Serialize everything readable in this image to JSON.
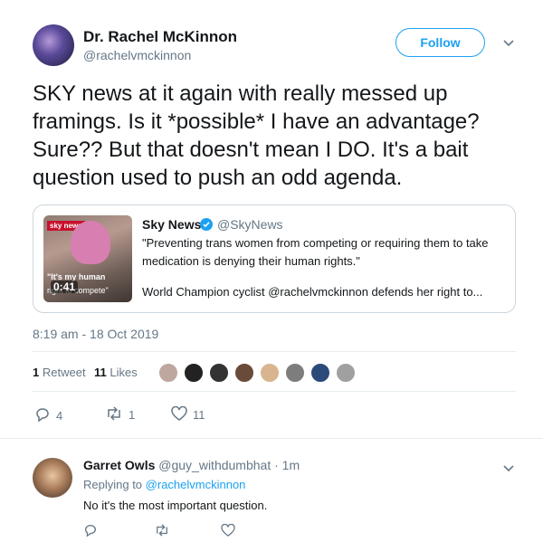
{
  "author": {
    "name": "Dr. Rachel McKinnon",
    "handle": "@rachelvmckinnon",
    "follow_label": "Follow"
  },
  "tweet": {
    "text": "SKY news at it again with really messed up framings. Is it *possible* I have an advantage? Sure?? But that doesn't mean I DO. It's a bait question used to push an odd agenda.",
    "timestamp": "8:19 am - 18 Oct 2019",
    "retweets": "1",
    "retweets_label": "Retweet",
    "likes": "11",
    "likes_label": "Likes",
    "reply_count": "4",
    "retweet_count": "1",
    "like_count": "11"
  },
  "quoted": {
    "name": "Sky News",
    "handle": "@SkyNews",
    "line1": "\"Preventing trans women from competing or requiring them to take",
    "line2": "medication is denying their human rights.\"",
    "line3": "World Champion cyclist @rachelvmckinnon defends her right to...",
    "thumb_logo": "sky news",
    "thumb_caption_1": "\"It's my human",
    "thumb_caption_2": "right to compete\"",
    "thumb_duration": "0:41"
  },
  "reply": {
    "name": "Garret Owls",
    "handle": "@guy_withdumbhat",
    "age": "1m",
    "replying_prefix": "Replying to",
    "replying_to": "@rachelvmckinnon",
    "text": "No it's the most important question."
  },
  "colors": {
    "accent": "#1da1f2",
    "muted": "#657786",
    "like_red": "#e0245e"
  }
}
